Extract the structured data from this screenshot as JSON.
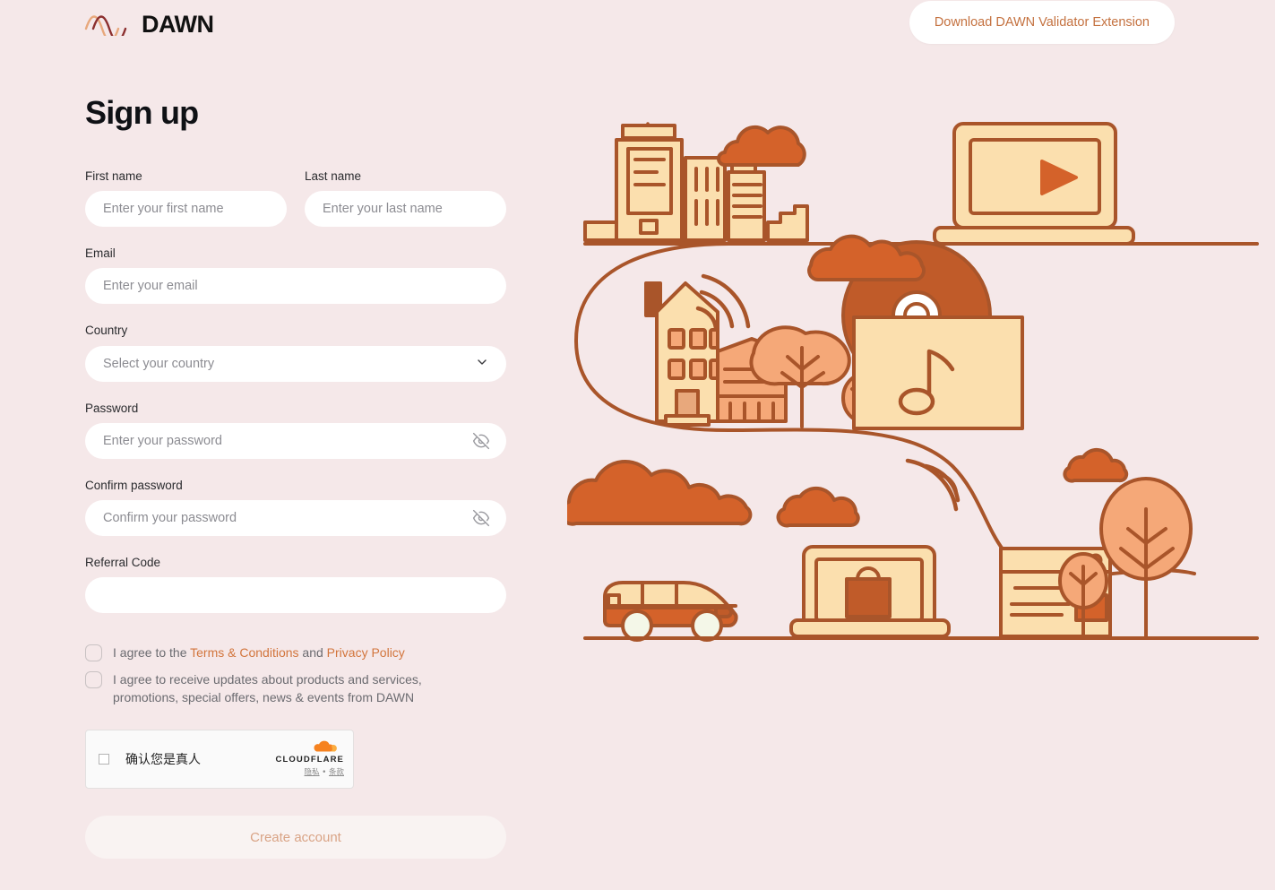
{
  "header": {
    "logo_text": "DAWN",
    "logo_mark_icon": "wave-logo-icon",
    "download_button": "Download DAWN Validator Extension"
  },
  "page": {
    "title": "Sign up"
  },
  "form": {
    "first_name": {
      "label": "First name",
      "placeholder": "Enter your first name",
      "value": ""
    },
    "last_name": {
      "label": "Last name",
      "placeholder": "Enter your last name",
      "value": ""
    },
    "email": {
      "label": "Email",
      "placeholder": "Enter your email",
      "value": ""
    },
    "country": {
      "label": "Country",
      "placeholder": "Select your country",
      "value": "Select your country",
      "chevron_icon": "chevron-down-icon"
    },
    "password": {
      "label": "Password",
      "placeholder": "Enter your password",
      "value": "",
      "toggle_icon": "eye-off-icon"
    },
    "confirm_password": {
      "label": "Confirm password",
      "placeholder": "Confirm your password",
      "value": "",
      "toggle_icon": "eye-off-icon"
    },
    "referral_code": {
      "label": "Referral Code",
      "placeholder": "",
      "value": ""
    }
  },
  "agreements": [
    {
      "checked": false,
      "text_before": "I agree to the ",
      "link1": "Terms & Conditions",
      "text_middle": " and ",
      "link2": "Privacy Policy",
      "text_after": ""
    },
    {
      "checked": false,
      "text_before": "I agree to receive updates about products and services, promotions, special offers, news & events from DAWN",
      "link1": "",
      "text_middle": "",
      "link2": "",
      "text_after": ""
    }
  ],
  "captcha": {
    "label": "确认您是真人",
    "brand": "CLOUDFLARE",
    "privacy_link": "隐私",
    "separator": " • ",
    "terms_link": "条款",
    "logo_icon": "cloudflare-cloud-icon",
    "checked": false
  },
  "submit": {
    "label": "Create account",
    "disabled": true
  },
  "colors": {
    "background": "#F5E8E9",
    "accent_orange": "#D2753C",
    "illustration_outline": "#A9552A",
    "illustration_fill_light": "#FBDFAE",
    "illustration_fill_mid": "#F5A878",
    "illustration_fill_dark": "#D4622A",
    "input_background": "#FFFFFF",
    "placeholder": "#8C8C92",
    "label": "#2A2B2E"
  },
  "illustration": {
    "name": "smart-city-connectivity-illustration",
    "elements": [
      "office-buildings",
      "cloud",
      "laptop-with-play-button",
      "house-with-wifi",
      "trees",
      "vinyl-record-music-player",
      "van",
      "laptop-with-shopping-bag",
      "browser-window-card",
      "winding-road-path",
      "wifi-arcs"
    ]
  }
}
